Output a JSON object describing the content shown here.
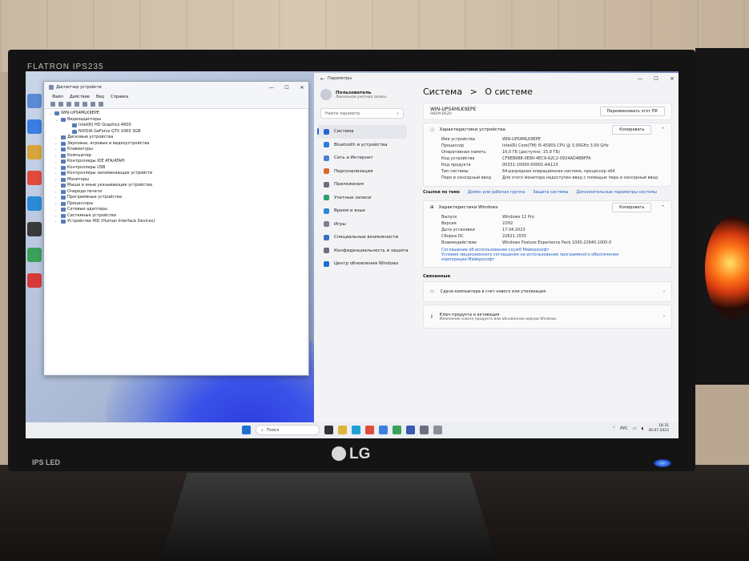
{
  "monitor": {
    "brand_top": "FLATRON IPS235",
    "brand_ips": "IPS LED",
    "brand_logo": "LG"
  },
  "device_manager": {
    "title": "Диспетчер устройств",
    "menu": [
      "Файл",
      "Действие",
      "Вид",
      "Справка"
    ],
    "tree": [
      {
        "label": "WIN-UPS4MLK9EPE",
        "level": "root"
      },
      {
        "label": "Видеоадаптеры",
        "level": "l1",
        "open": true
      },
      {
        "label": "Intel(R) HD Graphics 4600",
        "level": "l2"
      },
      {
        "label": "NVIDIA GeForce GTX 1060 3GB",
        "level": "l2"
      },
      {
        "label": "Дисковые устройства",
        "level": "l1"
      },
      {
        "label": "Звуковые, игровые и видеоустройства",
        "level": "l1"
      },
      {
        "label": "Клавиатуры",
        "level": "l1"
      },
      {
        "label": "Компьютер",
        "level": "l1"
      },
      {
        "label": "Контроллеры IDE ATA/ATAPI",
        "level": "l1"
      },
      {
        "label": "Контроллеры USB",
        "level": "l1"
      },
      {
        "label": "Контроллеры запоминающих устройств",
        "level": "l1"
      },
      {
        "label": "Мониторы",
        "level": "l1"
      },
      {
        "label": "Мыши и иные указывающие устройства",
        "level": "l1"
      },
      {
        "label": "Очереди печати",
        "level": "l1"
      },
      {
        "label": "Программные устройства",
        "level": "l1"
      },
      {
        "label": "Процессоры",
        "level": "l1"
      },
      {
        "label": "Сетевые адаптеры",
        "level": "l1"
      },
      {
        "label": "Системные устройства",
        "level": "l1"
      },
      {
        "label": "Устройства HID (Human Interface Devices)",
        "level": "l1"
      }
    ]
  },
  "settings": {
    "title": "Параметры",
    "user_name": "Пользователь",
    "user_sub": "Локальная учетная запись",
    "search_placeholder": "Найти параметр",
    "nav": [
      {
        "label": "Система",
        "color": "#2a63d6",
        "selected": true
      },
      {
        "label": "Bluetooth и устройства",
        "color": "#2a7fd6"
      },
      {
        "label": "Сеть и Интернет",
        "color": "#4a7fd6"
      },
      {
        "label": "Персонализация",
        "color": "#d66a2a"
      },
      {
        "label": "Приложения",
        "color": "#6a6f80"
      },
      {
        "label": "Учетные записи",
        "color": "#2aa06a"
      },
      {
        "label": "Время и язык",
        "color": "#2a8ad6"
      },
      {
        "label": "Игры",
        "color": "#7a7f90"
      },
      {
        "label": "Специальные возможности",
        "color": "#3a6fc6"
      },
      {
        "label": "Конфиденциальность и защита",
        "color": "#6a6f80"
      },
      {
        "label": "Центр обновления Windows",
        "color": "#1f6fd0"
      }
    ],
    "breadcrumb_parent": "Система",
    "breadcrumb_sep": ">",
    "breadcrumb_current": "О системе",
    "device_name": "WIN-UPS4MLK9EPE",
    "device_model": "H81M-DS2V",
    "rename_button": "Переименовать этот ПК",
    "device_specs": {
      "header": "Характеристики устройства",
      "copy_button": "Копировать",
      "rows": [
        {
          "k": "Имя устройства",
          "v": "WIN-UPS4MLK9EPE"
        },
        {
          "k": "Процессор",
          "v": "Intel(R) Core(TM) i5-4590S CPU @ 3.00GHz   3.00 GHz"
        },
        {
          "k": "Оперативная память",
          "v": "16,0 ГБ (доступно: 15,9 ГБ)"
        },
        {
          "k": "Код устройства",
          "v": "CF9EB988-0E80-4EC9-A2C2-0924AD4BBFFA"
        },
        {
          "k": "Код продукта",
          "v": "00331-10000-00001-AA123"
        },
        {
          "k": "Тип системы",
          "v": "64-разрядная операционная система, процессор x64"
        },
        {
          "k": "Перо и сенсорный ввод",
          "v": "Для этого монитора недоступен ввод с помощью пера и сенсорный ввод"
        }
      ]
    },
    "related_links": {
      "label": "Ссылки по теме",
      "items": [
        "Домен или рабочая группа",
        "Защита системы",
        "Дополнительные параметры системы"
      ]
    },
    "windows_specs": {
      "header": "Характеристики Windows",
      "copy_button": "Копировать",
      "rows": [
        {
          "k": "Выпуск",
          "v": "Windows 11 Pro"
        },
        {
          "k": "Версия",
          "v": "22H2"
        },
        {
          "k": "Дата установки",
          "v": "17.04.2023"
        },
        {
          "k": "Сборка ОС",
          "v": "22621.1555"
        },
        {
          "k": "Взаимодействие",
          "v": "Windows Feature Experience Pack 1000.22640.1000.0"
        }
      ],
      "link1": "Соглашение об использовании служб Майкрософт",
      "link2": "Условия лицензионного соглашения на использование программного обеспечения корпорации Майкрософт"
    },
    "related_header": "Связанные",
    "related": [
      {
        "title": "Сдача компьютера в счет нового или утилизация",
        "sub": ""
      },
      {
        "title": "Ключ продукта и активация",
        "sub": "Изменение ключа продукта или обновление версии Windows"
      }
    ]
  },
  "taskbar": {
    "search_label": "Поиск",
    "lang": "РУС",
    "time": "18:31",
    "date": "30.07.2023"
  }
}
